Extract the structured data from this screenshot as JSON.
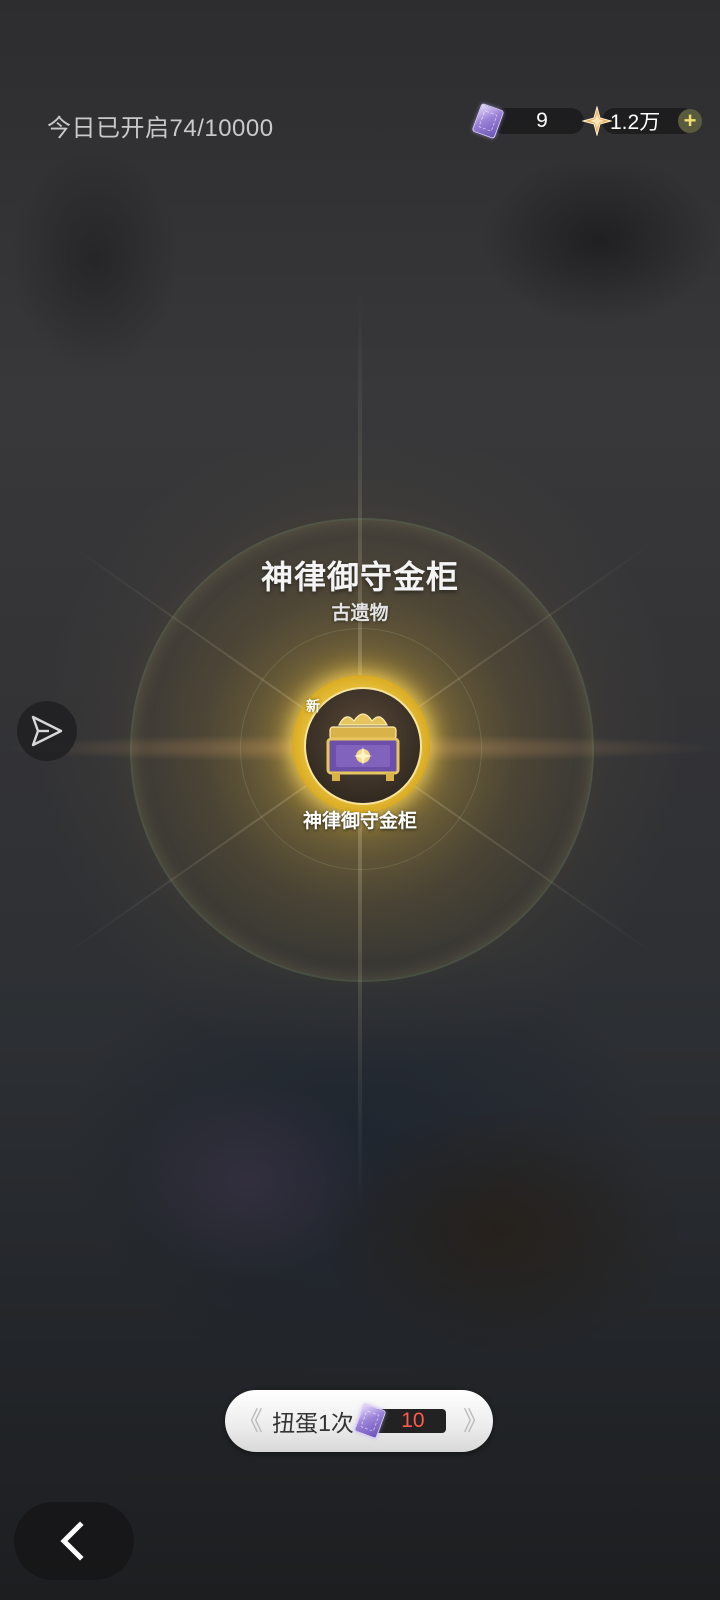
{
  "header": {
    "daily_opened_text": "今日已开启74/10000",
    "currencies": [
      {
        "icon": "purple-ticket-icon",
        "value": "9"
      },
      {
        "icon": "gold-star-icon",
        "value": "1.2万"
      }
    ],
    "add_icon": "plus-icon"
  },
  "item": {
    "name": "神律御守金柜",
    "type": "古遗物",
    "new_tag": "新",
    "label": "神律御守金柜",
    "frame_color": "#f4d453"
  },
  "side": {
    "share_icon": "share-send-icon"
  },
  "gacha_button": {
    "label": "扭蛋1次",
    "cost": "10",
    "cost_color": "#ff5a4e",
    "icon": "purple-ticket-icon"
  },
  "nav": {
    "back_icon": "back-arrow-icon"
  }
}
